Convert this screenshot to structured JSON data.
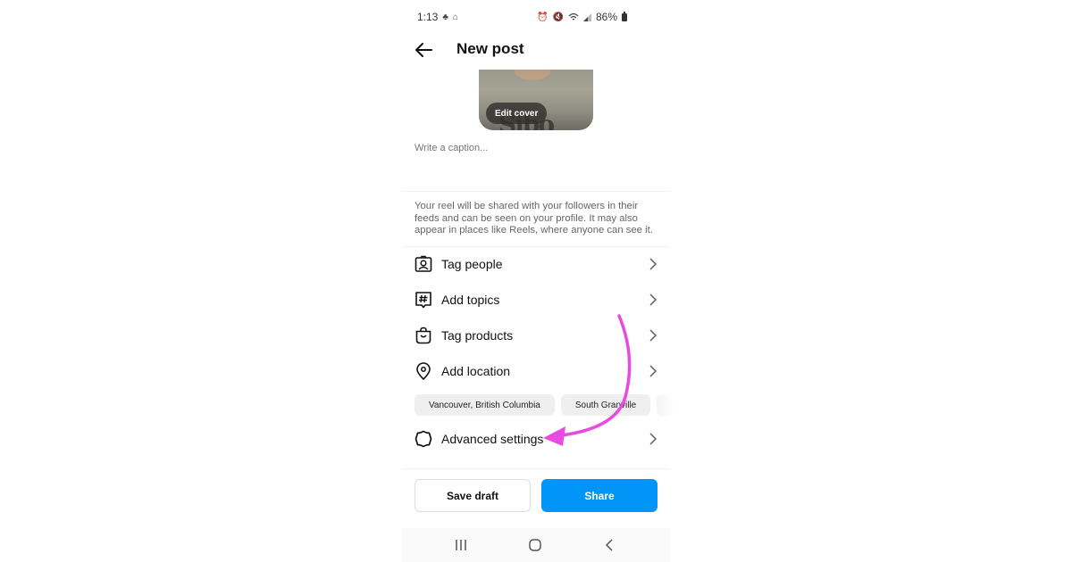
{
  "status_bar": {
    "time": "1:13",
    "battery": "86%",
    "left_icons": [
      "notification-icon",
      "home-notification-icon"
    ],
    "right_icons": [
      "alarm-icon",
      "mute-icon",
      "wifi-icon",
      "signal-icon",
      "battery-icon"
    ]
  },
  "header": {
    "back_icon": "arrow-left-icon",
    "title": "New post"
  },
  "cover": {
    "edit_label": "Edit cover"
  },
  "caption": {
    "placeholder": "Write a caption...",
    "value": ""
  },
  "info_text": "Your reel will be shared with your followers in their feeds and can be seen on your profile. It may also appear in places like Reels, where anyone can see it.",
  "menu": {
    "items": [
      {
        "label": "Tag people",
        "icon": "tag-person-icon"
      },
      {
        "label": "Add topics",
        "icon": "hashtag-icon"
      },
      {
        "label": "Tag products",
        "icon": "shopping-bag-icon"
      },
      {
        "label": "Add location",
        "icon": "location-pin-icon"
      },
      {
        "label": "Advanced settings",
        "icon": "settings-gear-icon"
      }
    ]
  },
  "location_suggestions": [
    "Vancouver, British Columbia",
    "South Granville"
  ],
  "actions": {
    "save_draft": "Save draft",
    "share": "Share"
  },
  "colors": {
    "share_button": "#0095f6",
    "annotation_arrow": "#e84be0"
  },
  "nav_bar": {
    "icons": [
      "recent-apps-icon",
      "home-icon",
      "back-icon"
    ]
  }
}
